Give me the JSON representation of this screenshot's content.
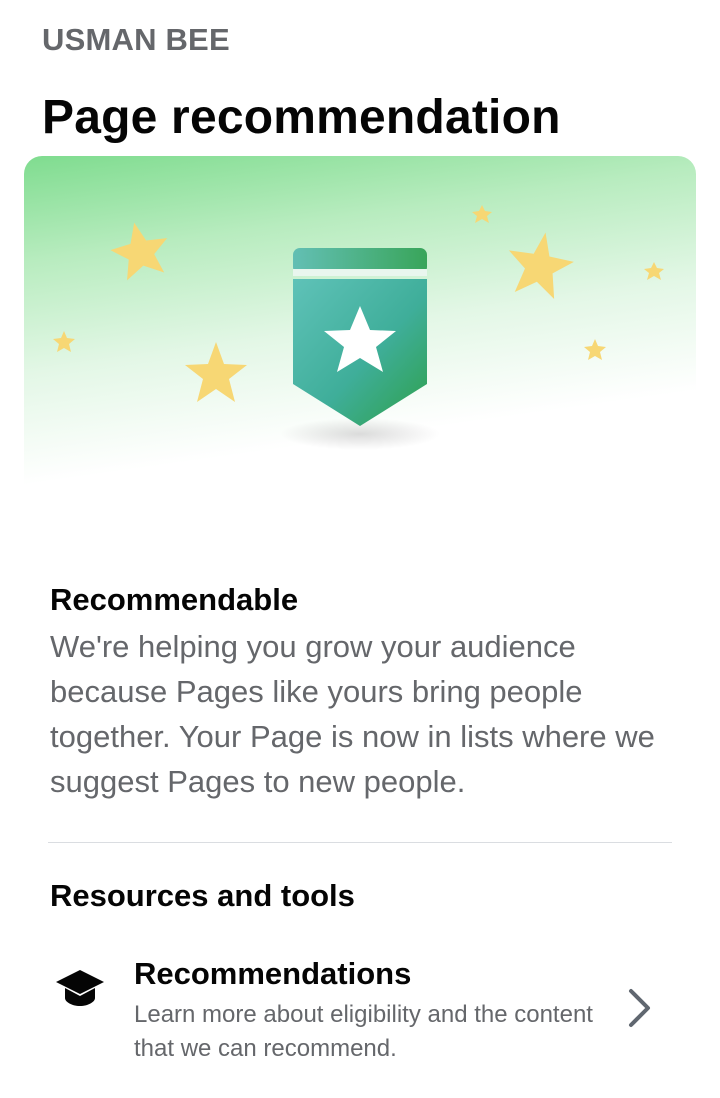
{
  "header": {
    "page_name": "USMAN BEE",
    "title": "Page recommendation"
  },
  "hero": {
    "graphic": "recommended-badge-with-stars",
    "colors": {
      "gradient_top": "#7fdc8f",
      "badge_teal": "#4db6ac",
      "badge_green": "#3aa757",
      "star": "#f7d774"
    }
  },
  "status": {
    "title": "Recommendable",
    "description": "We're helping you grow your audience because Pages like yours bring people together. Your Page is now in lists where we suggest Pages to new people."
  },
  "resources": {
    "title": "Resources and tools",
    "items": [
      {
        "icon": "graduation-cap-icon",
        "label": "Recommendations",
        "description": "Learn more about eligibility and the content that we can recommend.",
        "action_icon": "chevron-right-icon"
      }
    ]
  }
}
